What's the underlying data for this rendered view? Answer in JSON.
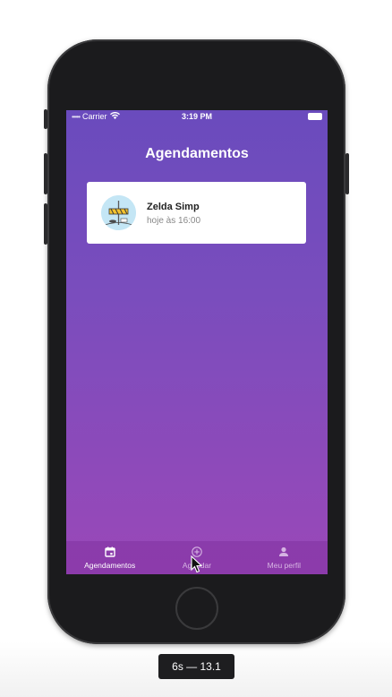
{
  "status_bar": {
    "signal_dots": "•••••",
    "carrier": "Carrier",
    "time": "3:19 PM"
  },
  "screen": {
    "title": "Agendamentos",
    "appointments": [
      {
        "name": "Zelda Simp",
        "time": "hoje às 16:00"
      }
    ]
  },
  "tab_bar": {
    "tabs": [
      {
        "label": "Agendamentos",
        "icon": "calendar-icon",
        "active": true
      },
      {
        "label": "Agendar",
        "icon": "add-circle-icon",
        "active": false
      },
      {
        "label": "Meu perfil",
        "icon": "person-icon",
        "active": false
      }
    ]
  },
  "simulator_label": "6s — 13.1",
  "colors": {
    "gradient_top": "#6a4bbd",
    "gradient_bottom": "#9a48b8",
    "card_bg": "#ffffff",
    "device_body": "#1b1b1d"
  }
}
